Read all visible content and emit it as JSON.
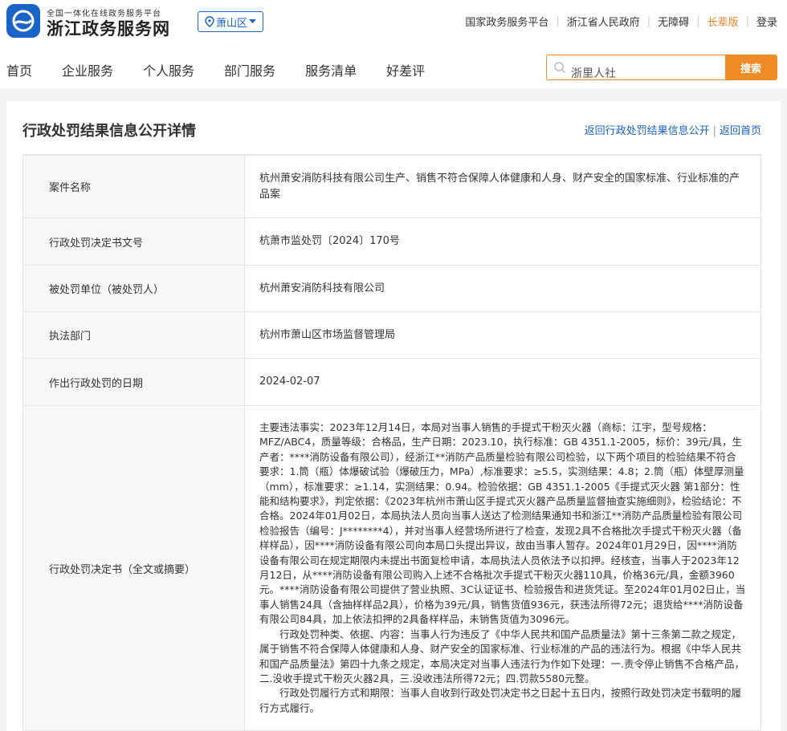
{
  "header": {
    "logo_subtitle": "全国一体化在线政务服务平台",
    "logo_title": "浙江政务服务网",
    "region": "萧山区",
    "top_links": [
      {
        "label": "国家政务服务平台"
      },
      {
        "label": "浙江省人民政府"
      },
      {
        "label": "无障碍"
      },
      {
        "label": "长辈版"
      },
      {
        "label": "登录"
      }
    ]
  },
  "nav": {
    "items": [
      {
        "label": "首页"
      },
      {
        "label": "企业服务"
      },
      {
        "label": "个人服务"
      },
      {
        "label": "部门服务"
      },
      {
        "label": "服务清单"
      },
      {
        "label": "好差评"
      }
    ]
  },
  "search": {
    "value": "浙里人社",
    "button_label": "搜索"
  },
  "page": {
    "title": "行政处罚结果信息公开详情",
    "back_link": "返回行政处罚结果信息公开",
    "home_link": "返回首页"
  },
  "details": {
    "rows": [
      {
        "label": "案件名称",
        "value": "杭州萧安消防科技有限公司生产、销售不符合保障人体健康和人身、财产安全的国家标准、行业标准的产品案"
      },
      {
        "label": "行政处罚决定书文号",
        "value": "杭萧市监处罚〔2024〕170号"
      },
      {
        "label": "被处罚单位（被处罚人）",
        "value": "杭州萧安消防科技有限公司"
      },
      {
        "label": "执法部门",
        "value": "杭州市萧山区市场监督管理局"
      },
      {
        "label": "作出行政处罚的日期",
        "value": "2024-02-07"
      }
    ],
    "decision_label": "行政处罚决定书（全文或摘要）",
    "decision_paragraphs": [
      "主要违法事实：2023年12月14日，本局对当事人销售的手提式干粉灭火器（商标：江宇，型号规格：MFZ/ABC4，质量等级：合格品，生产日期：2023.10，执行标准：GB 4351.1-2005，标价：39元/具，生产者：****消防设备有限公司），经浙江**消防产品质量检验有限公司检验，以下两个项目的检验结果不符合要求：1.筒（瓶）体爆破试验（爆破压力，MPa）,标准要求：≥5.5，实测结果：4.8；2.筒（瓶）体壁厚测量（mm），标准要求：≥1.14，实测结果：0.94。检验依据：GB 4351.1-2005《手提式灭火器 第1部分：性能和结构要求》，判定依据：《2023年杭州市萧山区手提式灭火器产品质量监督抽查实施细则》，检验结论：不合格。2024年01月02日，本局执法人员向当事人送达了检测结果通知书和浙江**消防产品质量检验有限公司检验报告（编号：J********4），并对当事人经营场所进行了检查，发现2具不合格批次手提式干粉灭火器（备样样品），因****消防设备有限公司向本局口头提出异议，故由当事人暂存。2024年01月29日，因****消防设备有限公司在规定期限内未提出书面复检申请，本局执法人员依法予以扣押。经核查，当事人于2023年12月12日，从****消防设备有限公司购入上述不合格批次手提式干粉灭火器110具，价格36元/具，金额3960元。****消防设备有限公司提供了营业执照、3C认证证书、检验报告和进货凭证。至2024年01月02日止，当事人销售24具（含抽样样品2具），价格为39元/具，销售货值936元，获违法所得72元；退货给****消防设备有限公司84具，加上依法扣押的2具备样样品，未销售货值为3096元。",
      "行政处罚种类、依据、内容：当事人行为违反了《中华人民共和国产品质量法》第十三条第二款之规定，属于销售不符合保障人体健康和人身、财产安全的国家标准、行业标准的产品的违法行为。根据《中华人民共和国产品质量法》第四十九条之规定，本局决定对当事人违法行为作如下处理：一.责令停止销售不合格产品，二.没收手提式干粉灭火器2具，三.没收违法所得72元；四.罚款5580元整。",
      "行政处罚履行方式和期限：当事人自收到行政处罚决定书之日起十五日内，按照行政处罚决定书载明的履行方式履行。"
    ]
  },
  "colors": {
    "brand_blue": "#1a63c7",
    "accent_orange": "#f08a24"
  },
  "icons": {
    "logo": "zhejiang-emblem-icon",
    "region": "location-pin-icon",
    "dropdown": "caret-down-icon",
    "search": "search-icon"
  }
}
